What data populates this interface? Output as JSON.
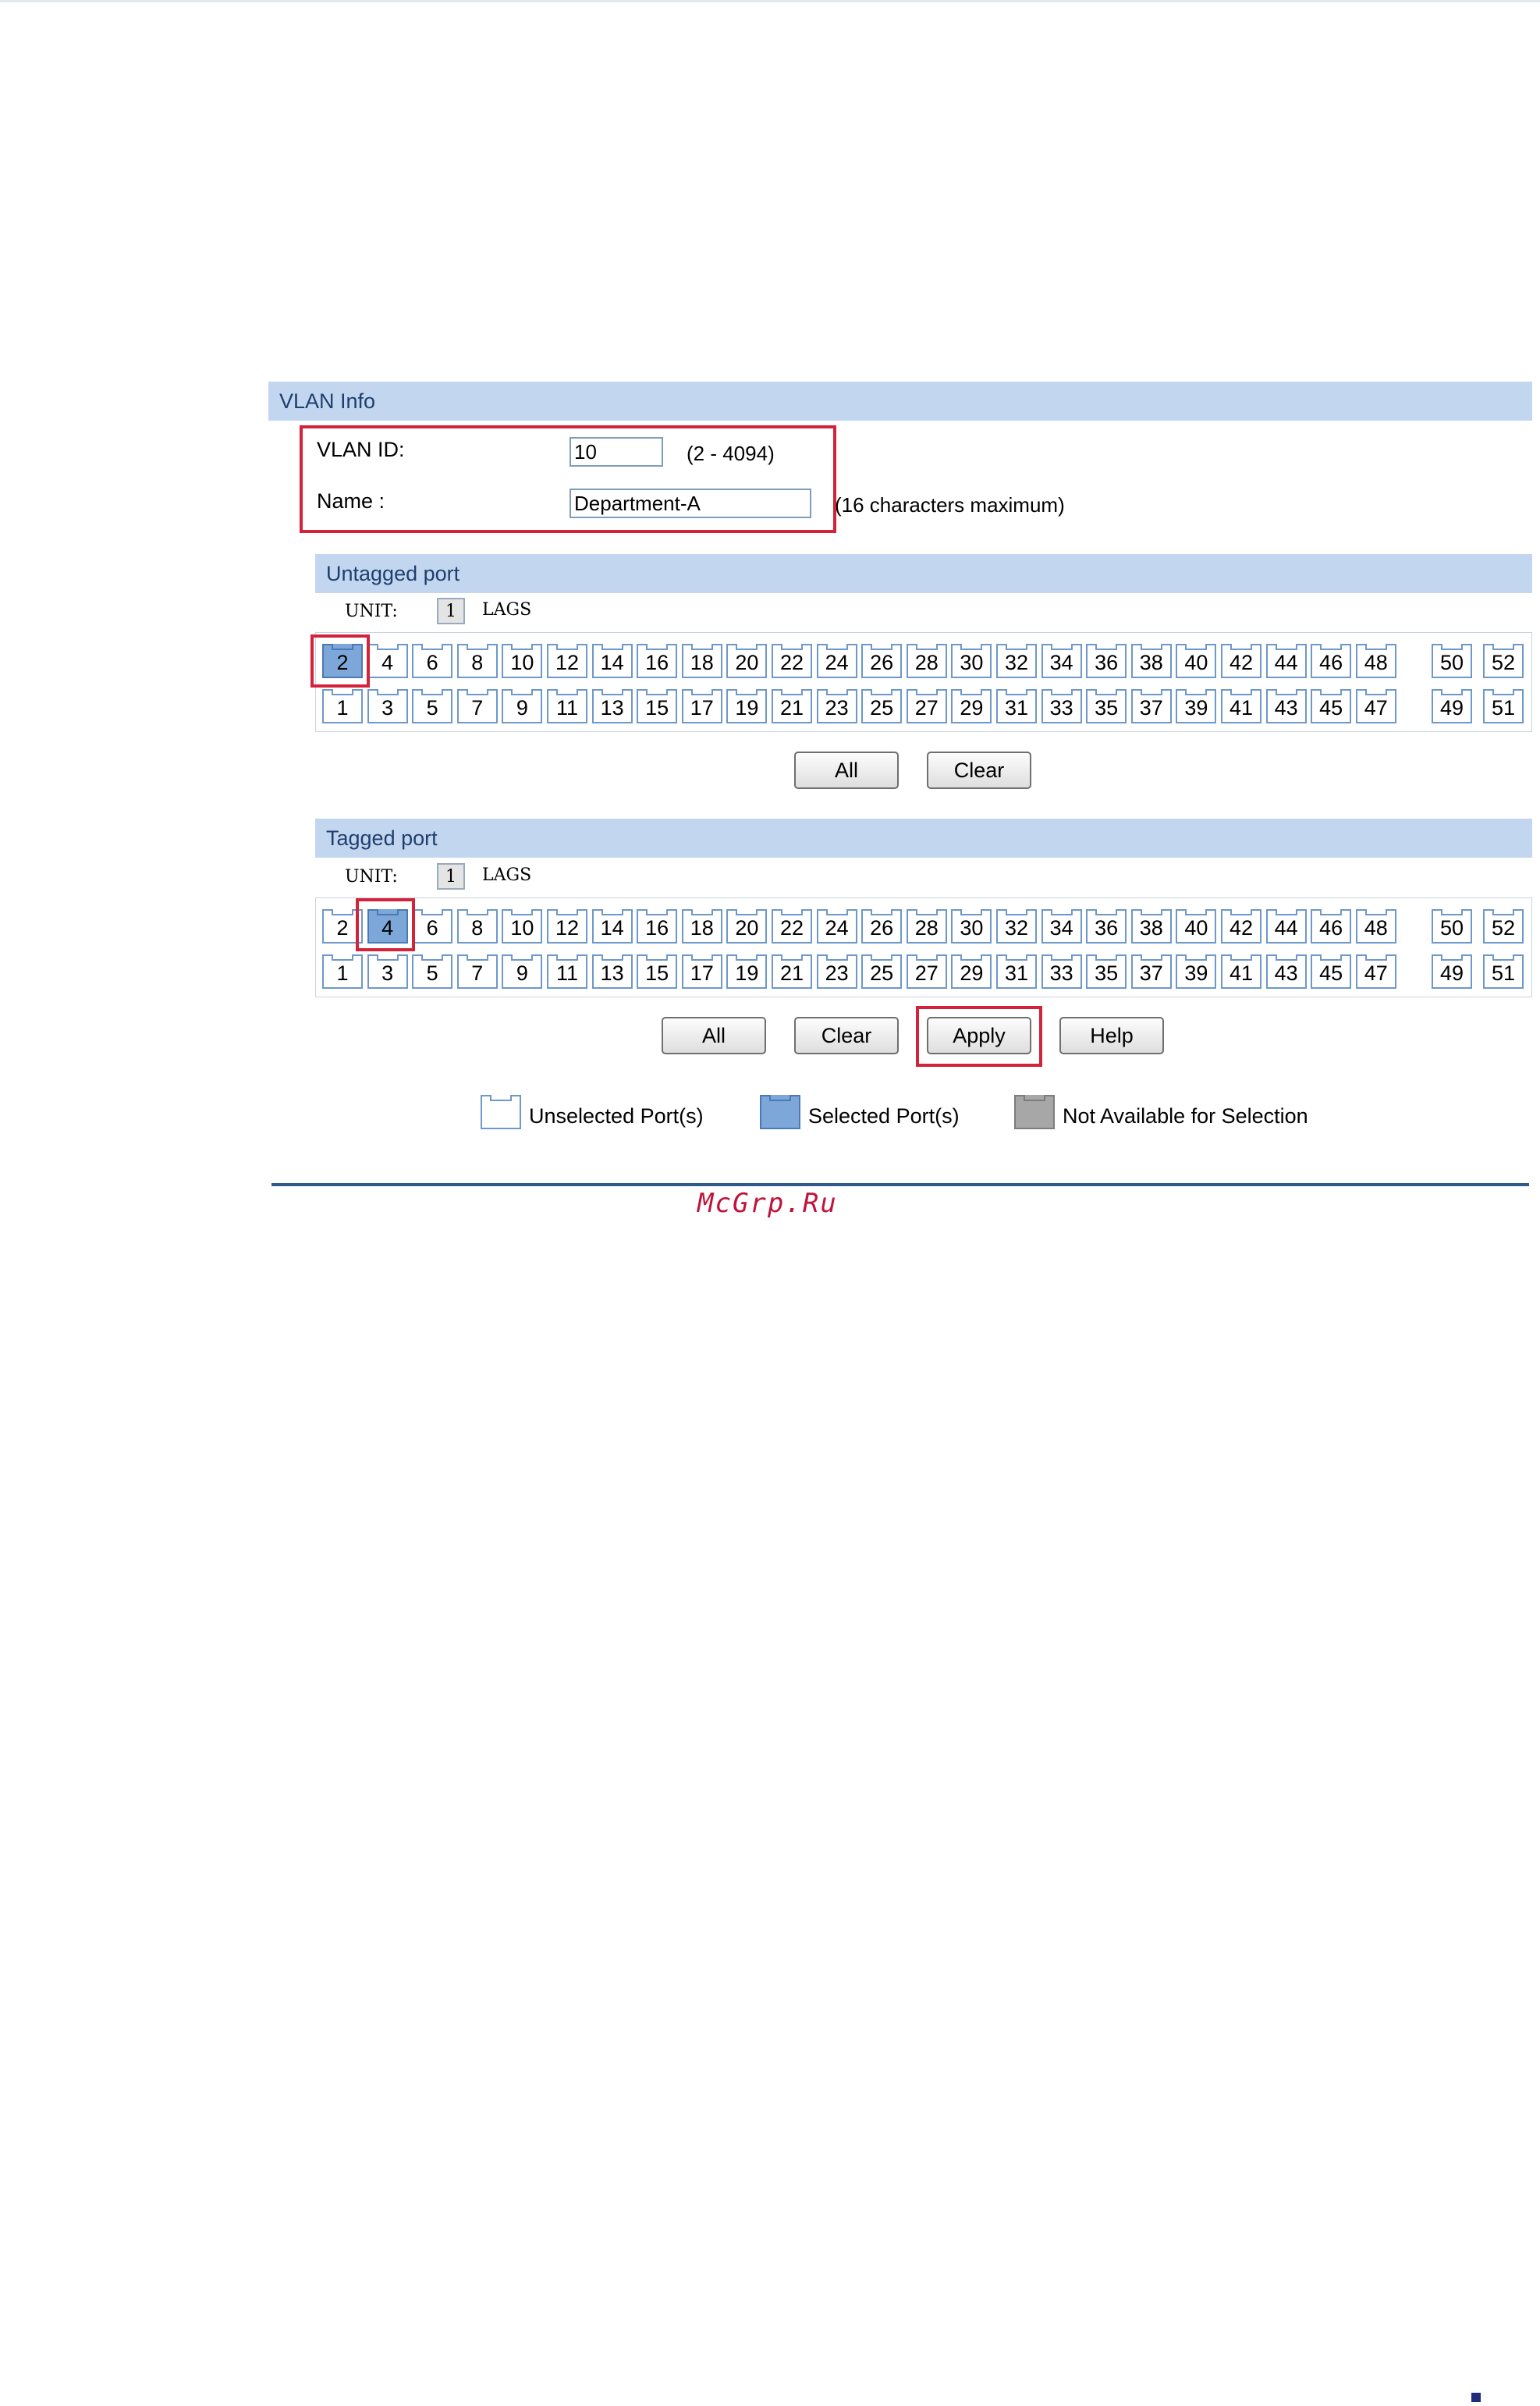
{
  "vlan_info": {
    "title": "VLAN Info",
    "vlan_id_label": "VLAN ID:",
    "vlan_id_value": "10",
    "vlan_id_range": "(2 - 4094)",
    "name_label": "Name :",
    "name_value": "Department-A",
    "name_hint": "(16 characters maximum)"
  },
  "untagged": {
    "title": "Untagged port",
    "unit_label": "UNIT:",
    "unit_value": "1",
    "lags_label": "LAGS",
    "selected_ports": [
      "2"
    ],
    "all_label": "All",
    "clear_label": "Clear"
  },
  "tagged": {
    "title": "Tagged port",
    "unit_label": "UNIT:",
    "unit_value": "1",
    "lags_label": "LAGS",
    "selected_ports": [
      "4"
    ],
    "all_label": "All",
    "clear_label": "Clear",
    "apply_label": "Apply",
    "help_label": "Help"
  },
  "ports": {
    "even": [
      "2",
      "4",
      "6",
      "8",
      "10",
      "12",
      "14",
      "16",
      "18",
      "20",
      "22",
      "24",
      "26",
      "28",
      "30",
      "32",
      "34",
      "36",
      "38",
      "40",
      "42",
      "44",
      "46",
      "48"
    ],
    "odd": [
      "1",
      "3",
      "5",
      "7",
      "9",
      "11",
      "13",
      "15",
      "17",
      "19",
      "21",
      "23",
      "25",
      "27",
      "29",
      "31",
      "33",
      "35",
      "37",
      "39",
      "41",
      "43",
      "45",
      "47"
    ],
    "extra_even": [
      "50",
      "52"
    ],
    "extra_odd": [
      "49",
      "51"
    ]
  },
  "legend": {
    "unselected": "Unselected Port(s)",
    "selected": "Selected Port(s)",
    "not_available": "Not Available for Selection"
  },
  "watermark": "McGrp.Ru",
  "colors": {
    "bar_bg": "#c2d6ef",
    "port_border": "#6d98c9",
    "port_selected": "#7da7d9",
    "highlight_red": "#d2233a",
    "watermark": "#c0143c"
  }
}
